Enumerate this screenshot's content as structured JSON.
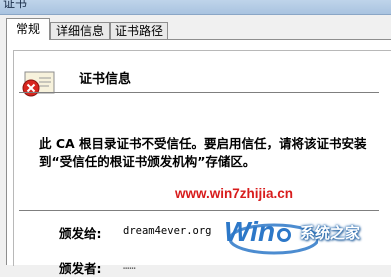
{
  "window": {
    "title": "证书"
  },
  "tabs": [
    {
      "label": "常规"
    },
    {
      "label": "详细信息"
    },
    {
      "label": "证书路径"
    }
  ],
  "cert_info": {
    "heading": "证书信息",
    "warning": "此 CA 根目录证书不受信任。要启用信任，请将该证书安装到“受信任的根证书颁发机构”存储区。"
  },
  "fields": {
    "issued_to_label": "颁发给:",
    "issued_to_value": "dream4ever.org",
    "issued_by_label": "颁发者:"
  },
  "watermark": {
    "url": "www.win7zhijia.cn",
    "logo_text": "Win",
    "brand": "系统之家"
  }
}
